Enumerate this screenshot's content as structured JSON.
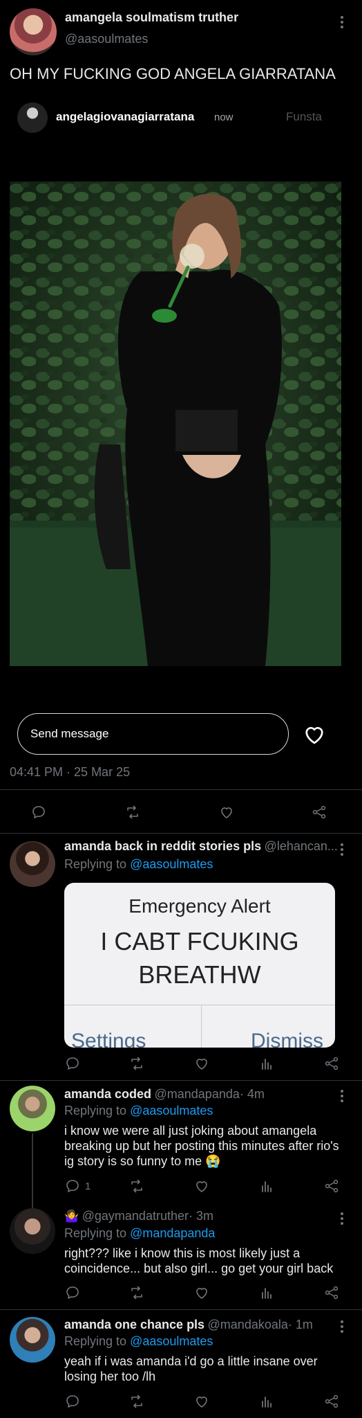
{
  "main_tweet": {
    "display_name": "amangela soulmatism truther",
    "handle": "@aasoulmates",
    "text": "OH MY FUCKING GOD ANGELA GIARRATANA",
    "story": {
      "username": "angelagiovanagiarratana",
      "time": "now",
      "label": "Funsta",
      "photo_alt": "woman in black shirt drinking from a wine glass in front of ivy wall",
      "message_placeholder": "Send message"
    },
    "timestamp": "04:41 PM · 25 Mar 25"
  },
  "replies": [
    {
      "display_name": "amanda back in reddit stories pls",
      "handle": "@lehancan...",
      "replying_to": "@aasoulmates",
      "replying_prefix": "Replying to",
      "media": {
        "title": "Emergency Alert",
        "body_line1": "I CABT FCUKING",
        "body_line2": "BREATHW",
        "button_left": "Settings",
        "button_right": "Dismiss"
      }
    },
    {
      "display_name": "amanda coded",
      "handle": "@mandapanda",
      "time": "· 4m",
      "replying_prefix": "Replying to",
      "replying_to": "@aasoulmates",
      "text": "i know we were all just joking about amangela breaking up but her posting this minutes after rio's ig story is so funny to me 😭",
      "reply_count": "1"
    },
    {
      "display_name_emoji": "🤷‍♀️",
      "handle": "@gaymandatruther",
      "time": "· 3m",
      "replying_prefix": "Replying to",
      "replying_to": "@mandapanda",
      "text": "right??? like i know this is most likely just a coincidence... but also girl... go get your girl back"
    },
    {
      "display_name": "amanda one chance pls",
      "handle": "@mandakoala",
      "time": "· 1m",
      "replying_prefix": "Replying to",
      "replying_to": "@aasoulmates",
      "text": "yeah if i was amanda i'd go a little insane over losing her too /lh"
    }
  ],
  "icons": [
    "reply-icon",
    "retweet-icon",
    "like-icon",
    "views-icon",
    "share-icon",
    "more-icon",
    "heart-icon"
  ],
  "colors": {
    "background": "#000000",
    "link": "#1d9bf0",
    "muted": "#71767b",
    "divider": "#2f3336"
  }
}
